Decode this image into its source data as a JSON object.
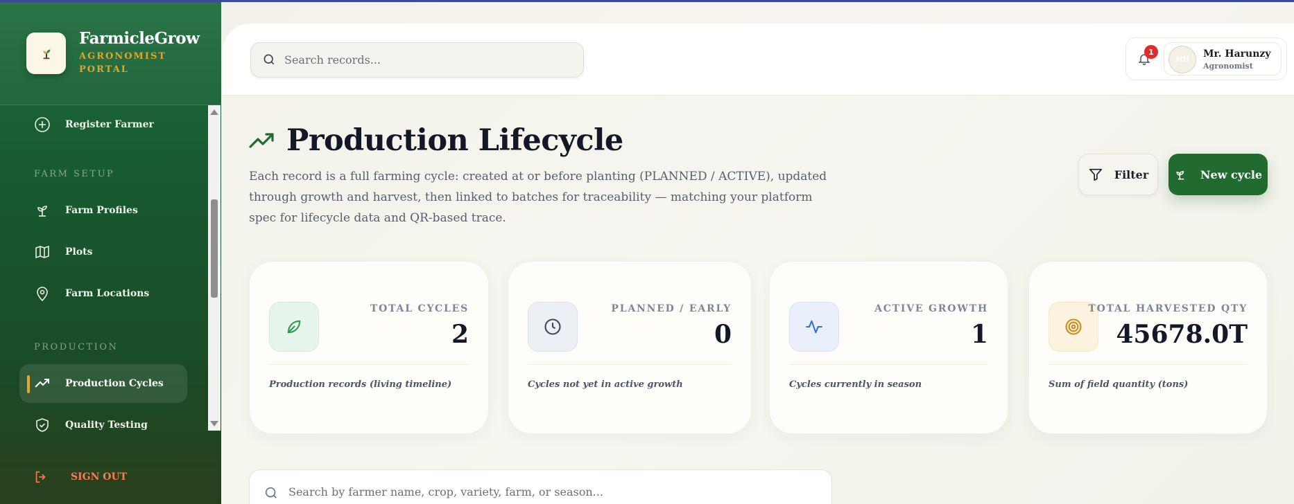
{
  "brand": {
    "name": "FarmicleGrow",
    "subtitle": "AGRONOMIST PORTAL"
  },
  "sidebar": {
    "items": [
      {
        "label": "Register Farmer",
        "icon": "plus-circle-icon"
      },
      {
        "label": "Farm Profiles",
        "icon": "sprout-icon"
      },
      {
        "label": "Plots",
        "icon": "map-icon"
      },
      {
        "label": "Farm Locations",
        "icon": "map-pin-icon"
      },
      {
        "label": "Production Cycles",
        "icon": "trending-up-icon",
        "active": true
      },
      {
        "label": "Quality Testing",
        "icon": "shield-check-icon"
      }
    ],
    "sections": {
      "farm_setup": "FARM SETUP",
      "production": "PRODUCTION"
    },
    "sign_out": "SIGN OUT"
  },
  "topbar": {
    "search_placeholder": "Search records...",
    "notification_count": "1",
    "user": {
      "initials": "MH",
      "name": "Mr. Harunzy",
      "role": "Agronomist"
    }
  },
  "page": {
    "title": "Production Lifecycle",
    "description": "Each record is a full farming cycle: created at or before planting (PLANNED / ACTIVE), updated through growth and harvest, then linked to batches for traceability — matching your platform spec for lifecycle data and QR-based trace.",
    "filter_label": "Filter",
    "new_cycle_label": "New cycle"
  },
  "stats": [
    {
      "label": "TOTAL CYCLES",
      "value": "2",
      "note": "Production records (living timeline)",
      "icon": "leaf-icon",
      "accent": "#2e9a5a"
    },
    {
      "label": "PLANNED / EARLY",
      "value": "0",
      "note": "Cycles not yet in active growth",
      "icon": "clock-icon",
      "accent": "#3a4a5c"
    },
    {
      "label": "ACTIVE GROWTH",
      "value": "1",
      "note": "Cycles currently in season",
      "icon": "activity-icon",
      "accent": "#2f6fd6"
    },
    {
      "label": "TOTAL HARVESTED QTY",
      "value": "45678.0T",
      "note": "Sum of field quantity (tons)",
      "icon": "target-icon",
      "accent": "#d08a17"
    }
  ],
  "table_search": {
    "placeholder": "Search by farmer name, crop, variety, farm, or season..."
  },
  "colors": {
    "primary": "#216b31",
    "accent_gold": "#e8a62a",
    "sign_out": "#ff7a55"
  }
}
